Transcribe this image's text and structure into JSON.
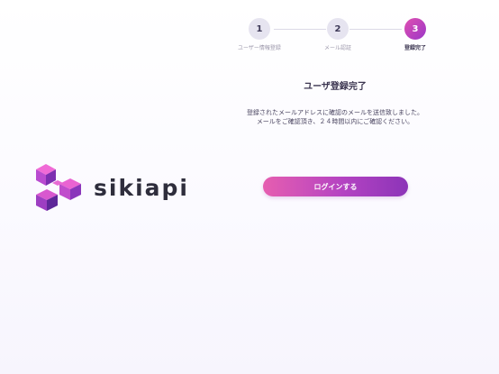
{
  "brand": {
    "name": "sikiapi",
    "logo_icon": "sikiapi-cube-logo"
  },
  "stepper": {
    "current_step": 3,
    "steps": [
      {
        "number": "1",
        "label": "ユーザー情報登録"
      },
      {
        "number": "2",
        "label": "メール認証"
      },
      {
        "number": "3",
        "label": "登録完了"
      }
    ]
  },
  "content": {
    "title": "ユーザ登録完了",
    "message_line1": "登録されたメールアドレスに確認のメールを送信致しました。",
    "message_line2": "メールをご確認頂き、２４時間以内にご確認ください。"
  },
  "actions": {
    "login_label": "ログインする"
  },
  "colors": {
    "accent_start": "#e65eb0",
    "accent_end": "#8c34b8",
    "inactive_step": "#e6e4f0",
    "text_dark": "#3b3550"
  }
}
